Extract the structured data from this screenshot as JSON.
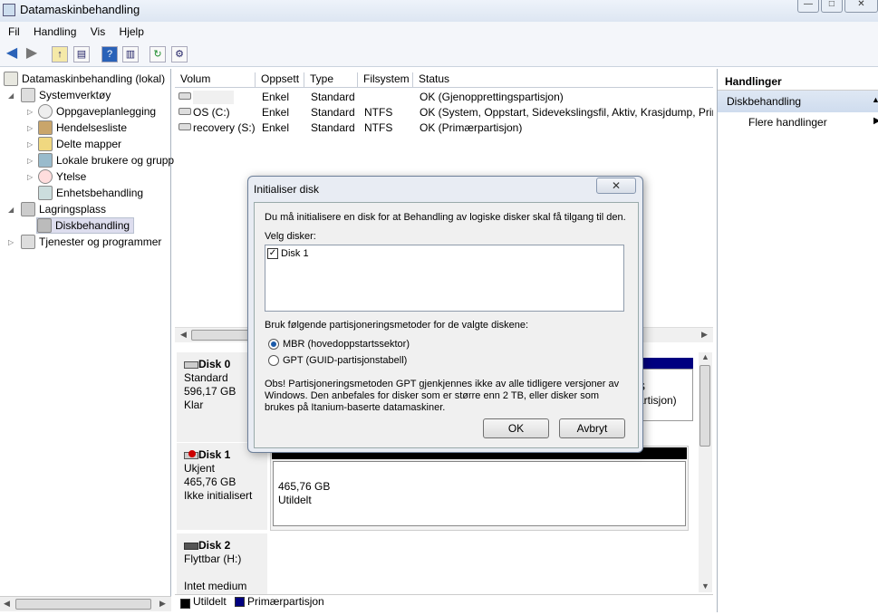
{
  "window": {
    "title": "Datamaskinbehandling",
    "controls": [
      "—",
      "□",
      "✕"
    ]
  },
  "menu": [
    "Fil",
    "Handling",
    "Vis",
    "Hjelp"
  ],
  "tree": {
    "root": "Datamaskinbehandling (lokal)",
    "systemtools": "Systemverktøy",
    "items": [
      "Oppgaveplanlegging",
      "Hendelsesliste",
      "Delte mapper",
      "Lokale brukere og grupp",
      "Ytelse",
      "Enhetsbehandling"
    ],
    "storage": "Lagringsplass",
    "diskmgmt": "Diskbehandling",
    "services": "Tjenester og programmer"
  },
  "volumes": {
    "headers": [
      "Volum",
      "Oppsett",
      "Type",
      "Filsystem",
      "Status"
    ],
    "rows": [
      {
        "name": "",
        "layout": "Enkel",
        "type": "Standard",
        "fs": "",
        "status": "OK (Gjenopprettingspartisjon)"
      },
      {
        "name": "OS (C:)",
        "layout": "Enkel",
        "type": "Standard",
        "fs": "NTFS",
        "status": "OK (System, Oppstart, Sidevekslingsfil, Aktiv, Krasjdump, Prim"
      },
      {
        "name": "recovery (S:)",
        "layout": "Enkel",
        "type": "Standard",
        "fs": "NTFS",
        "status": "OK (Primærpartisjon)"
      }
    ]
  },
  "disks": {
    "disk0": {
      "name": "Disk 0",
      "l1": "Standard",
      "l2": "596,17 GB",
      "l3": "Klar",
      "partial1": "S",
      "partial2": "artisjon)"
    },
    "disk1": {
      "name": "Disk 1",
      "l1": "Ukjent",
      "l2": "465,76 GB",
      "l3": "Ikke initialisert",
      "psize": "465,76 GB",
      "pstate": "Utildelt"
    },
    "disk2": {
      "name": "Disk 2",
      "l1": "Flyttbar (H:)",
      "l3": "Intet medium"
    }
  },
  "legend": [
    "Utildelt",
    "Primærpartisjon"
  ],
  "colors": {
    "unallocated": "#000000",
    "primary": "#000080"
  },
  "actions": {
    "title": "Handlinger",
    "section": "Diskbehandling",
    "more": "Flere handlinger"
  },
  "dialog": {
    "title": "Initialiser disk",
    "close": "✕",
    "intro": "Du må initialisere en disk for at Behandling av logiske disker skal få tilgang til den.",
    "select_label": "Velg disker:",
    "disk_item": "Disk 1",
    "method_label": "Bruk følgende partisjoneringsmetoder for de valgte diskene:",
    "mbr": "MBR (hovedoppstartssektor)",
    "gpt": "GPT (GUID-partisjonstabell)",
    "note": "Obs!  Partisjoneringsmetoden GPT gjenkjennes ikke av alle tidligere versjoner av Windows. Den anbefales for disker som er større enn 2 TB, eller disker som brukes på Itanium-baserte datamaskiner.",
    "ok": "OK",
    "cancel": "Avbryt"
  }
}
